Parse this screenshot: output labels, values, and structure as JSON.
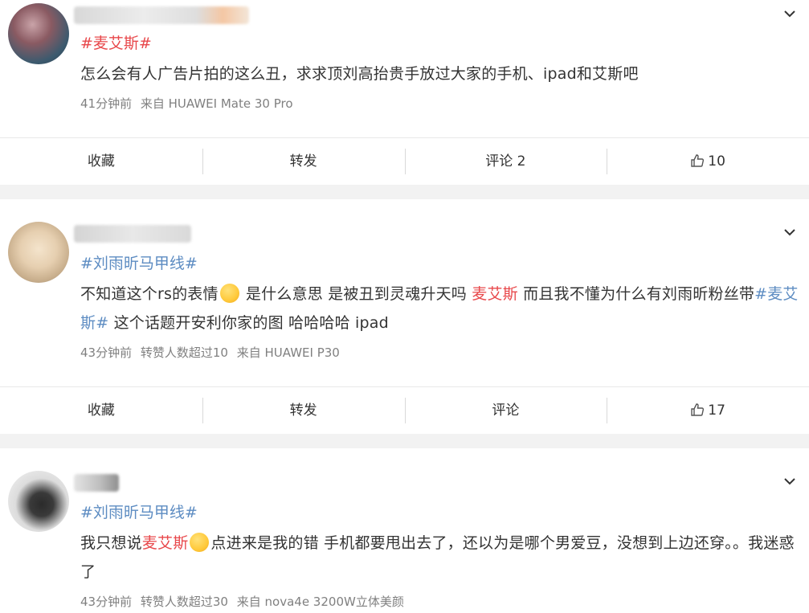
{
  "posts": [
    {
      "topic": "#麦艾斯#",
      "text": "怎么会有人广告片拍的这么丑，求求顶刘高抬贵手放过大家的手机、ipad和艾斯吧",
      "time": "41分钟前",
      "source": "来自 HUAWEI Mate 30 Pro",
      "actions": {
        "collect": "收藏",
        "forward": "转发",
        "comment": "评论 2",
        "like": "10"
      }
    },
    {
      "topic": "#刘雨昕马甲线#",
      "text_a": "不知道这个rs的表情",
      "text_b": " 是什么意思 是被丑到灵魂升天吗 ",
      "text_red": "麦艾斯",
      "text_c": " 而且我不懂为什么有刘雨昕粉丝带",
      "text_topic": "#麦艾斯#",
      "text_d": " 这个话题开安利你家的图 哈哈哈哈 ipad",
      "time": "43分钟前",
      "reposts": "转赞人数超过10",
      "source": "来自 HUAWEI P30",
      "actions": {
        "collect": "收藏",
        "forward": "转发",
        "comment": "评论",
        "like": "17"
      }
    },
    {
      "topic": "#刘雨昕马甲线#",
      "text_a": "我只想说",
      "text_red": "麦艾斯",
      "text_b": "点进来是我的错 手机都要甩出去了，还以为是哪个男爱豆，没想到上边还穿。。我迷惑了",
      "time": "43分钟前",
      "reposts": "转赞人数超过30",
      "source": "来自 nova4e 3200W立体美颜"
    }
  ],
  "colors": {
    "topic_orange": "#eb7350",
    "topic_blue": "#5d8cc2",
    "highlight_red": "#e8484b"
  }
}
